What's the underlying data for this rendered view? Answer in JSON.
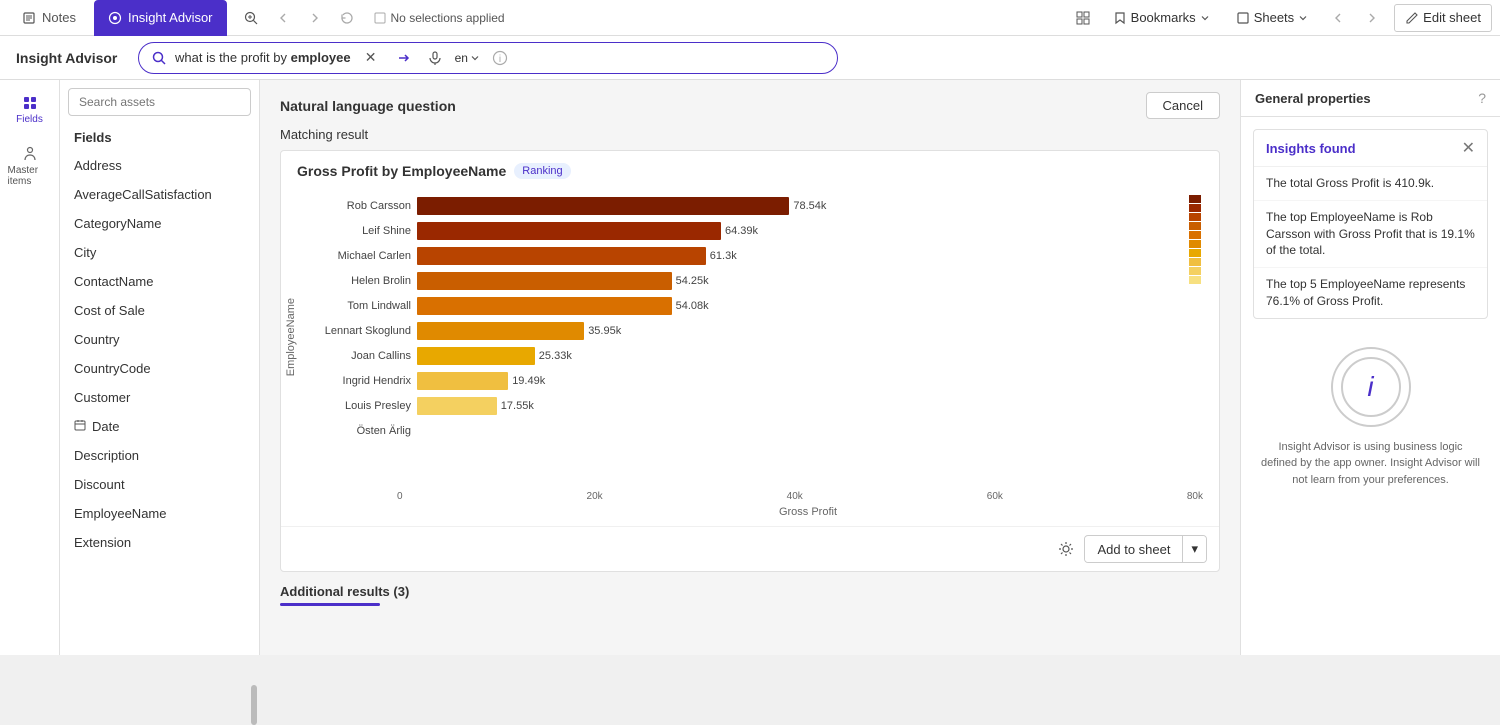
{
  "topbar": {
    "tabs": [
      {
        "id": "notes",
        "label": "Notes",
        "active": false
      },
      {
        "id": "insight",
        "label": "Insight Advisor",
        "active": true
      }
    ],
    "selection_status": "No selections applied",
    "bookmarks_label": "Bookmarks",
    "sheets_label": "Sheets",
    "edit_sheet_label": "Edit sheet"
  },
  "secondbar": {
    "title": "Insight Advisor",
    "search_query": "what is the profit by employee",
    "search_query_bold": "profit",
    "lang": "en"
  },
  "left_panel": {
    "search_assets_placeholder": "Search assets",
    "fields_header": "Fields",
    "fields": [
      {
        "label": "Address",
        "type": "text"
      },
      {
        "label": "AverageCallSatisfaction",
        "type": "text"
      },
      {
        "label": "CategoryName",
        "type": "text"
      },
      {
        "label": "City",
        "type": "text"
      },
      {
        "label": "ContactName",
        "type": "text"
      },
      {
        "label": "Cost of Sale",
        "type": "text"
      },
      {
        "label": "Country",
        "type": "text"
      },
      {
        "label": "CountryCode",
        "type": "text"
      },
      {
        "label": "Customer",
        "type": "text"
      },
      {
        "label": "Date",
        "type": "calendar"
      },
      {
        "label": "Description",
        "type": "text"
      },
      {
        "label": "Discount",
        "type": "text"
      },
      {
        "label": "EmployeeName",
        "type": "text"
      },
      {
        "label": "Extension",
        "type": "text"
      }
    ],
    "fields_icon_label": "Fields",
    "master_items_icon_label": "Master items"
  },
  "nlq": {
    "header": "Natural language question",
    "cancel_label": "Cancel",
    "matching_result_label": "Matching result"
  },
  "chart": {
    "title": "Gross Profit by EmployeeName",
    "badge": "Ranking",
    "y_axis_label": "EmployeeName",
    "x_axis_label": "Gross Profit",
    "x_ticks": [
      "0",
      "20k",
      "40k",
      "60k",
      "80k"
    ],
    "bars": [
      {
        "label": "Rob Carsson",
        "value": 78.54,
        "value_label": "78.54k",
        "pct": 98,
        "color": "#7b1d00"
      },
      {
        "label": "Leif Shine",
        "value": 64.39,
        "value_label": "64.39k",
        "pct": 80,
        "color": "#9a2800"
      },
      {
        "label": "Michael Carlen",
        "value": 61.3,
        "value_label": "61.3k",
        "pct": 76,
        "color": "#b84400"
      },
      {
        "label": "Helen Brolin",
        "value": 54.25,
        "value_label": "54.25k",
        "pct": 67,
        "color": "#c95e00"
      },
      {
        "label": "Tom Lindwall",
        "value": 54.08,
        "value_label": "54.08k",
        "pct": 67,
        "color": "#d97000"
      },
      {
        "label": "Lennart Skoglund",
        "value": 35.95,
        "value_label": "35.95k",
        "pct": 44,
        "color": "#e08a00"
      },
      {
        "label": "Joan Callins",
        "value": 25.33,
        "value_label": "25.33k",
        "pct": 31,
        "color": "#e8a800"
      },
      {
        "label": "Ingrid Hendrix",
        "value": 19.49,
        "value_label": "19.49k",
        "pct": 24,
        "color": "#f0bf40"
      },
      {
        "label": "Louis Presley",
        "value": 17.55,
        "value_label": "17.55k",
        "pct": 21,
        "color": "#f4d060"
      },
      {
        "label": "Östen Ärlig",
        "value": 0,
        "value_label": "",
        "pct": 0,
        "color": "#f7e080"
      }
    ],
    "add_to_sheet_label": "Add to sheet"
  },
  "additional_results": {
    "label": "Additional results (3)"
  },
  "insights": {
    "title": "Insights found",
    "items": [
      "The total Gross Profit is 410.9k.",
      "The top EmployeeName is Rob Carsson with Gross Profit that is 19.1% of the total.",
      "The top 5 EmployeeName represents 76.1% of Gross Profit."
    ]
  },
  "general_props": {
    "title": "General properties",
    "info_text": "Insight Advisor is using business logic defined by the app owner. Insight Advisor will not learn from your preferences."
  }
}
